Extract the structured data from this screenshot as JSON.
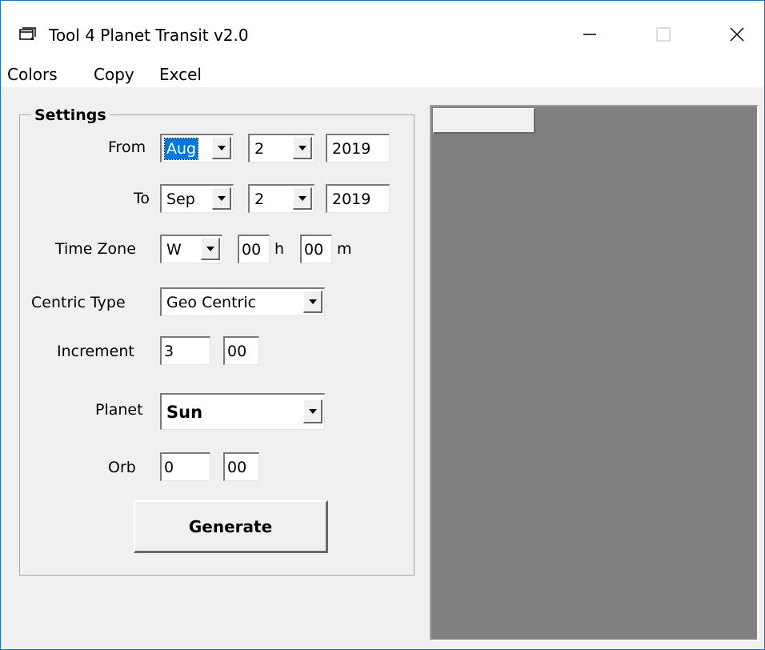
{
  "window": {
    "title": "Tool 4 Planet Transit v2.0",
    "icon": "app-window-icon",
    "controls": [
      "minimize-icon",
      "maximize-icon",
      "close-icon"
    ]
  },
  "menu": {
    "colors": "Colors",
    "copy": "Copy",
    "excel": "Excel"
  },
  "settings": {
    "title": "Settings",
    "from": {
      "label": "From",
      "month": "Aug",
      "day": "2",
      "year": "2019"
    },
    "to": {
      "label": "To",
      "month": "Sep",
      "day": "2",
      "year": "2019"
    },
    "time_zone": {
      "label": "Time Zone",
      "direction": "W",
      "hours": "00",
      "h_label": "h",
      "minutes": "00",
      "m_label": "m"
    },
    "centric_type": {
      "label": "Centric Type",
      "value": "Geo Centric"
    },
    "increment": {
      "label": "Increment",
      "value1": "3",
      "value2": "00"
    },
    "planet": {
      "label": "Planet",
      "value": "Sun"
    },
    "orb": {
      "label": "Orb",
      "value1": "0",
      "value2": "00"
    },
    "generate": "Generate"
  },
  "output_panel": {
    "background": "#808080"
  },
  "colors": {
    "selection": "#0078d7",
    "window_border": "#1a6fc9"
  }
}
